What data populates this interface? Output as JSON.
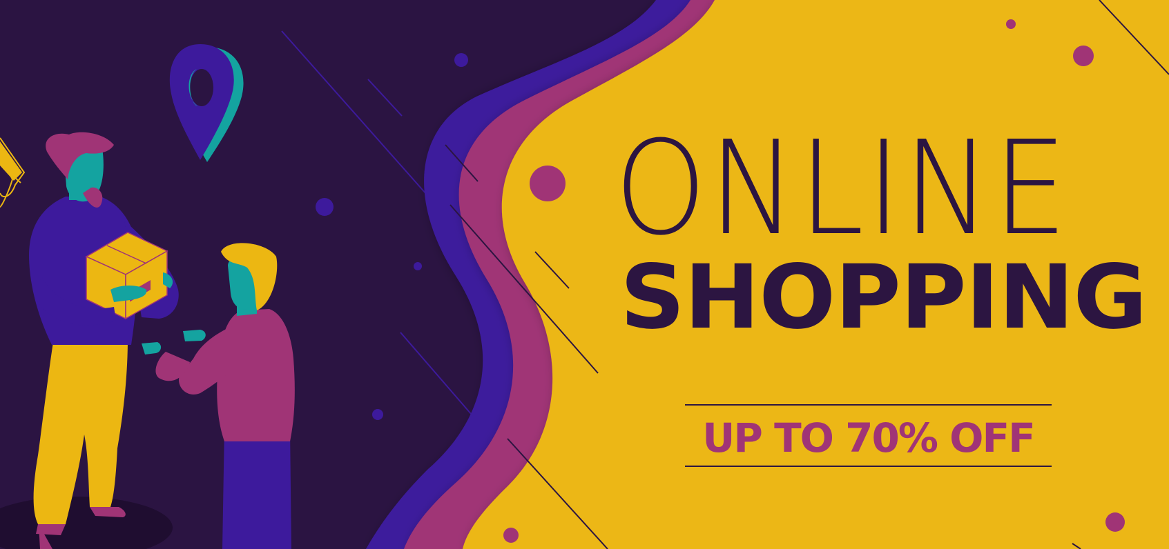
{
  "banner": {
    "headline_line1": "ONLINE",
    "headline_line2": "SHOPPING",
    "offer": "UP TO 70% OFF"
  },
  "colors": {
    "dark_purple_bg": "#2b1442",
    "yellow_bg": "#ecb712",
    "magenta_accent": "#a03476",
    "indigo_accent": "#3d1a9c",
    "teal_accent": "#14a3a0",
    "text_dark": "#2c1541"
  },
  "illustration": {
    "icons": [
      "location-pin-icon",
      "shopping-awning-icon",
      "delivery-box"
    ],
    "people": [
      "delivery-person",
      "customer"
    ]
  }
}
